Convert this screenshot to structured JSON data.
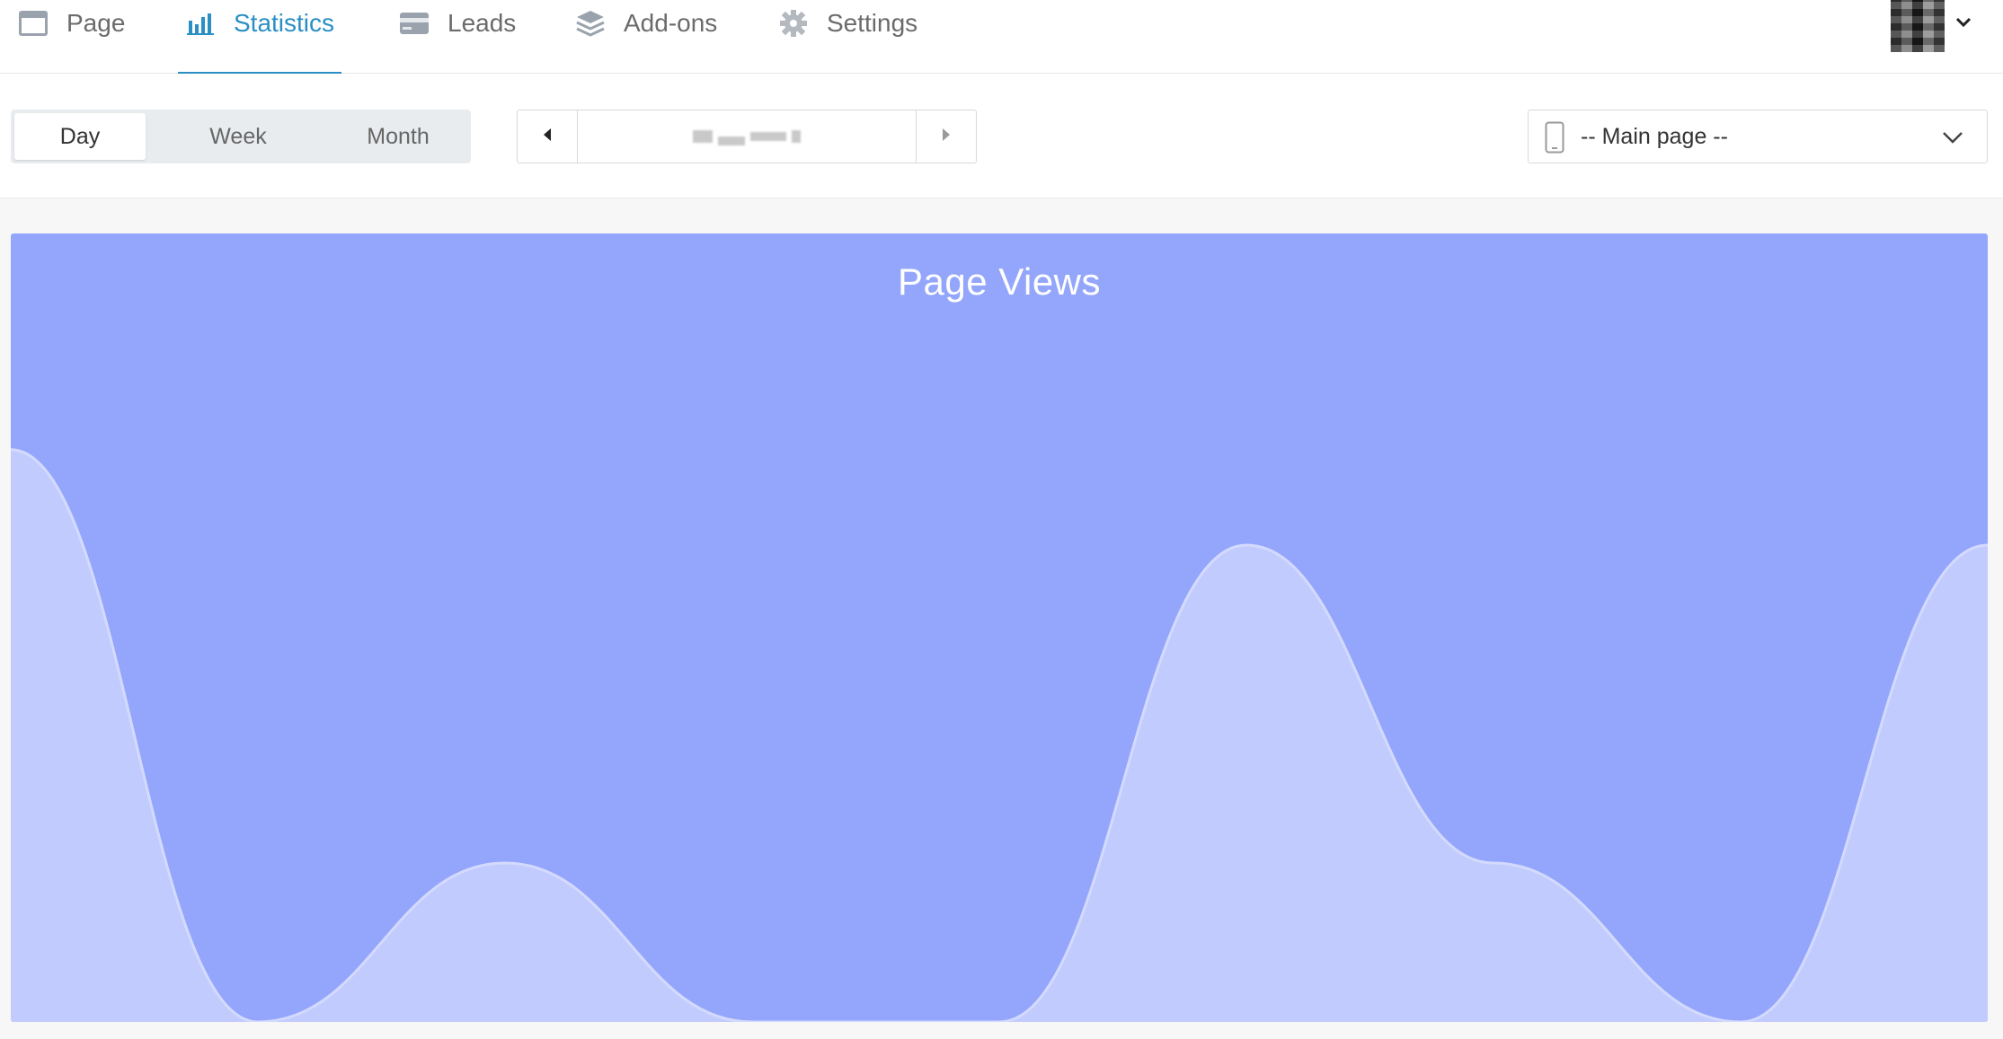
{
  "nav": {
    "items": [
      {
        "key": "page",
        "label": "Page",
        "icon": "page-icon",
        "active": false
      },
      {
        "key": "statistics",
        "label": "Statistics",
        "icon": "bar-chart-icon",
        "active": true
      },
      {
        "key": "leads",
        "label": "Leads",
        "icon": "card-icon",
        "active": false
      },
      {
        "key": "addons",
        "label": "Add-ons",
        "icon": "layers-icon",
        "active": false
      },
      {
        "key": "settings",
        "label": "Settings",
        "icon": "gear-icon",
        "active": false
      }
    ],
    "active_color": "#2a8fc4"
  },
  "range_tabs": {
    "day": "Day",
    "week": "Week",
    "month": "Month",
    "selected": "Day"
  },
  "page_select": {
    "selected": "-- Main page --",
    "icon": "phone-icon"
  },
  "chart_data": {
    "type": "area",
    "title": "Page Views",
    "xlabel": "",
    "ylabel": "",
    "grid": false,
    "legend": "none",
    "x": [
      0,
      1,
      2,
      3,
      4,
      5,
      6,
      7,
      8,
      9
    ],
    "values": [
      0.9,
      0.0,
      0.25,
      0.0,
      0.0,
      0.75,
      0.25,
      0.0,
      0.75
    ],
    "ylim": [
      0,
      1
    ],
    "colors": {
      "background": "#93a6fb",
      "fill": "#c2cbfd",
      "line": "#d4dafe"
    }
  }
}
